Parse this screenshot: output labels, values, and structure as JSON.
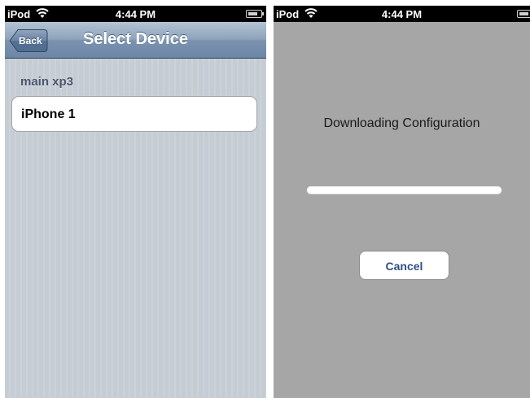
{
  "left_screen": {
    "status": {
      "carrier": "iPod",
      "time": "4:44 PM",
      "battery_level": 0.8
    },
    "nav": {
      "back_label": "Back",
      "title": "Select Device"
    },
    "section_header": "main xp3",
    "cells": [
      {
        "label": "iPhone 1"
      }
    ]
  },
  "right_screen": {
    "status": {
      "carrier": "iPod",
      "time": "4:44 PM",
      "battery_level": 0.8
    },
    "message": "Downloading Configuration",
    "progress": 1.0,
    "cancel_label": "Cancel"
  },
  "colors": {
    "nav_tint": "#6c86a6",
    "alert_background": "#a6a6a6",
    "button_text": "#324f85"
  }
}
